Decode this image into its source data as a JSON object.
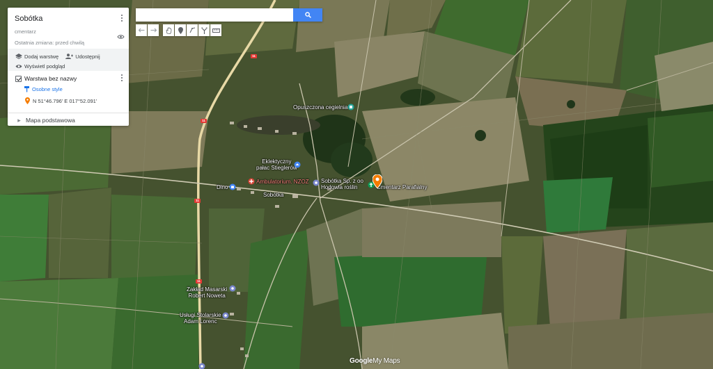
{
  "panel": {
    "title": "Sobótka",
    "description": "cmentarz",
    "last_edit": "Ostatnia zmiana: przed chwilą",
    "actions": {
      "add_layer": "Dodaj warstwę",
      "share": "Udostępnij",
      "preview": "Wyświetl podgląd"
    },
    "layer": {
      "name": "Warstwa bez nazwy",
      "style_link": "Osobne style",
      "place": "N 51°46.796' E 017°52.091'"
    },
    "base_map": "Mapa podstawowa"
  },
  "search": {
    "value": "",
    "placeholder": ""
  },
  "toolbar": [
    {
      "icon": "undo-icon"
    },
    {
      "icon": "redo-icon"
    },
    {
      "icon": "hand-icon"
    },
    {
      "icon": "add-marker-icon"
    },
    {
      "icon": "draw-line-icon"
    },
    {
      "icon": "directions-icon"
    },
    {
      "icon": "ruler-icon"
    }
  ],
  "map": {
    "labels": {
      "cegielnia": "Opuszczona cegielnia",
      "palac_1": "Eklektyczny",
      "palac_2": "pałac Stieglerów",
      "ambulatorium": "Ambulatorium. NZOZ",
      "dino": "Dino",
      "sobotka_firm_1": "Sobótka Sp. z oo",
      "sobotka_firm_2": "Hodowla roślin",
      "cmentarz": "Cmentarz Parafialny",
      "village": "Sobótka",
      "zaklad_1": "Zakład Masarski",
      "zaklad_2": "Robert Noweta",
      "uslugi_1": "Usługi Stolarskie",
      "uslugi_2": "Adam Lorenc"
    },
    "road_number": "11",
    "colors": {
      "marker": "#f57c00",
      "poi_blue": "#4285f4",
      "poi_green": "#0f9d58",
      "poi_red": "#db4437",
      "poi_gray": "#7986cb"
    }
  },
  "logo": {
    "google": "Google",
    "product": "My Maps"
  }
}
